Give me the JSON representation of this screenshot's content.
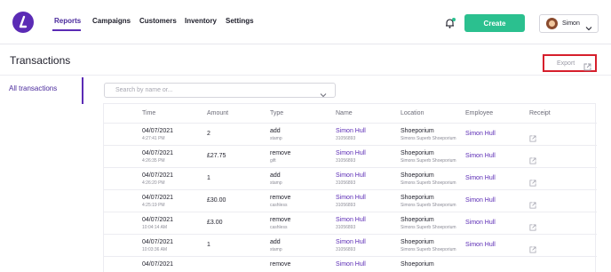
{
  "nav": {
    "items": [
      "Reports",
      "Campaigns",
      "Customers",
      "Inventory",
      "Settings"
    ],
    "create_label": "Create",
    "user_name": "Simon"
  },
  "page": {
    "title": "Transactions",
    "export_label": "Export"
  },
  "sidebar": {
    "items": [
      "All transactions"
    ]
  },
  "search": {
    "placeholder": "Search by name or..."
  },
  "table": {
    "headers": [
      "Time",
      "Amount",
      "Type",
      "Name",
      "Location",
      "Employee",
      "Receipt"
    ],
    "rows": [
      {
        "date": "04/07/2021",
        "time": "4:27:41 PM",
        "amount": "2",
        "type": "add",
        "type_sub": "stamp",
        "name": "Simon Hull",
        "name_sub": "31056893",
        "location": "Shoeporium",
        "location_sub": "Simons Superb Shoeporium",
        "employee": "Simon Hull"
      },
      {
        "date": "04/07/2021",
        "time": "4:26:35 PM",
        "amount": "£27.75",
        "type": "remove",
        "type_sub": "gift",
        "name": "Simon Hull",
        "name_sub": "31056893",
        "location": "Shoeporium",
        "location_sub": "Simons Superb Shoeporium",
        "employee": "Simon Hull"
      },
      {
        "date": "04/07/2021",
        "time": "4:26:20 PM",
        "amount": "1",
        "type": "add",
        "type_sub": "stamp",
        "name": "Simon Hull",
        "name_sub": "31056893",
        "location": "Shoeporium",
        "location_sub": "Simons Superb Shoeporium",
        "employee": "Simon Hull"
      },
      {
        "date": "04/07/2021",
        "time": "4:25:19 PM",
        "amount": "£30.00",
        "type": "remove",
        "type_sub": "cashless",
        "name": "Simon Hull",
        "name_sub": "31056893",
        "location": "Shoeporium",
        "location_sub": "Simons Superb Shoeporium",
        "employee": "Simon Hull"
      },
      {
        "date": "04/07/2021",
        "time": "10:04:14 AM",
        "amount": "£3.00",
        "type": "remove",
        "type_sub": "cashless",
        "name": "Simon Hull",
        "name_sub": "31056893",
        "location": "Shoeporium",
        "location_sub": "Simons Superb Shoeporium",
        "employee": "Simon Hull"
      },
      {
        "date": "04/07/2021",
        "time": "10:03:36 AM",
        "amount": "1",
        "type": "add",
        "type_sub": "stamp",
        "name": "Simon Hull",
        "name_sub": "31056893",
        "location": "Shoeporium",
        "location_sub": "Simons Superb Shoeporium",
        "employee": "Simon Hull"
      },
      {
        "date": "04/07/2021",
        "time": "",
        "amount": "",
        "type": "remove",
        "type_sub": "",
        "name": "Simon Hull",
        "name_sub": "",
        "location": "Shoeporium",
        "location_sub": "",
        "employee": ""
      }
    ]
  },
  "icons": {
    "logo": "brand-logo-icon",
    "bell": "bell-notification-icon",
    "chevron": "chevron-down-icon",
    "export": "external-link-icon",
    "receipt": "external-link-icon"
  },
  "colors": {
    "brand": "#5b2bb5",
    "create": "#2bc08f",
    "export_highlight": "#d61f2c",
    "notification_dot": "#2bc08f"
  }
}
